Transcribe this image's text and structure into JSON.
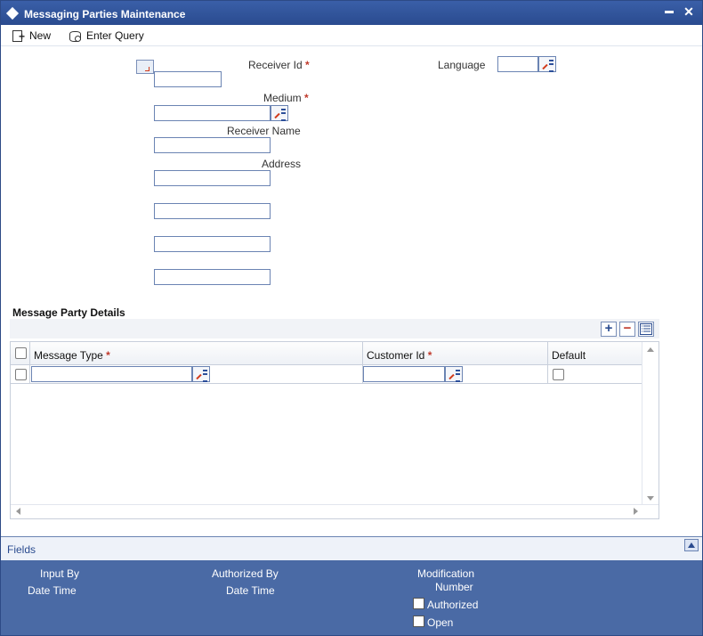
{
  "window": {
    "title": "Messaging Parties Maintenance",
    "minimize_glyph": "▬",
    "close_glyph": "✕"
  },
  "toolbar": {
    "new_label": "New",
    "enter_query_label": "Enter Query"
  },
  "form": {
    "receiver_id_label": "Receiver Id",
    "language_label": "Language",
    "medium_label": "Medium",
    "receiver_name_label": "Receiver Name",
    "address_label": "Address",
    "required_mark": "*",
    "receiver_id_value": "",
    "language_value": "",
    "medium_value": "",
    "receiver_name_value": "",
    "address_line1": "",
    "address_line2": "",
    "address_line3": "",
    "address_line4": ""
  },
  "details": {
    "section_title": "Message Party Details",
    "add_glyph": "+",
    "remove_glyph": "−",
    "columns": [
      "Message Type",
      "Customer Id",
      "Default"
    ],
    "rows": [
      {
        "message_type": "",
        "customer_id": "",
        "default": false
      }
    ]
  },
  "fields_bar": {
    "label": "Fields"
  },
  "audit": {
    "input_by_label": "Input By",
    "date_time_label_1": "Date Time",
    "authorized_by_label": "Authorized By",
    "date_time_label_2": "Date Time",
    "modification_label": "Modification",
    "number_label": "Number",
    "authorized_label": "Authorized",
    "open_label": "Open"
  },
  "colors": {
    "title_bar": "#2d4f95",
    "footer": "#4a6aa5",
    "required": "#c0392b",
    "link": "#2a4b8f"
  },
  "icons": [
    "new-icon",
    "enter-query-icon",
    "lov-icon",
    "add-row-icon",
    "delete-row-icon",
    "single-view-icon",
    "collapse-icon"
  ]
}
